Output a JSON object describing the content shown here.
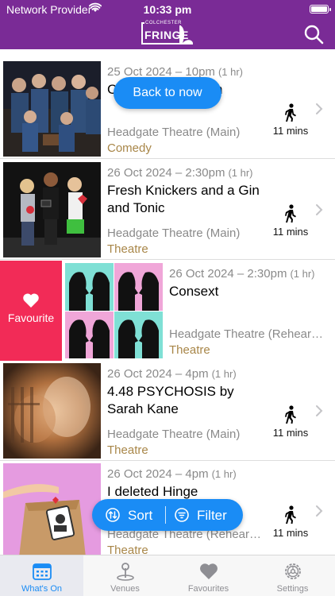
{
  "status_bar": {
    "carrier": "Network Provider",
    "time": "10:33 pm"
  },
  "header": {
    "logo_small": "COLCHESTER",
    "logo_big": "FRINGE",
    "search_icon": "search-icon"
  },
  "back_to_now_label": "Back to now",
  "events": [
    {
      "date": "25 Oct 2024 – 10pm",
      "duration": "(1 hr)",
      "title": "Crew Improvisation",
      "venue": "Headgate Theatre (Main)",
      "category": "Comedy",
      "walk": "11 mins"
    },
    {
      "date": "26 Oct 2024 – 2:30pm",
      "duration": "(1 hr)",
      "title": "Fresh Knickers and a Gin and Tonic",
      "venue": "Headgate Theatre (Main)",
      "category": "Theatre",
      "walk": "11 mins"
    },
    {
      "date": "26 Oct 2024 – 2:30pm",
      "duration": "(1 hr)",
      "title": "Consext",
      "venue": "Headgate Theatre (Rehearsal Room)",
      "category": "Theatre",
      "favourite_label": "Favourite"
    },
    {
      "date": "26 Oct 2024 – 4pm",
      "duration": "(1 hr)",
      "title": "4.48 PSYCHOSIS by Sarah Kane",
      "venue": "Headgate Theatre (Main)",
      "category": "Theatre",
      "walk": "11 mins"
    },
    {
      "date": "26 Oct 2024 – 4pm",
      "duration": "(1 hr)",
      "title": "I deleted Hinge",
      "venue": "Headgate Theatre (Rehearsal Room)",
      "category": "Theatre",
      "walk": "11 mins"
    }
  ],
  "sort_filter": {
    "sort_label": "Sort",
    "filter_label": "Filter"
  },
  "tabs": [
    {
      "label": "What's On",
      "icon": "calendar-icon",
      "active": true
    },
    {
      "label": "Venues",
      "icon": "map-pin-icon",
      "active": false
    },
    {
      "label": "Favourites",
      "icon": "heart-icon",
      "active": false
    },
    {
      "label": "Settings",
      "icon": "gear-icon",
      "active": false
    }
  ],
  "colors": {
    "header": "#7a2b96",
    "accent": "#1a8cf5",
    "favourite": "#f22b57",
    "category": "#a88648"
  }
}
